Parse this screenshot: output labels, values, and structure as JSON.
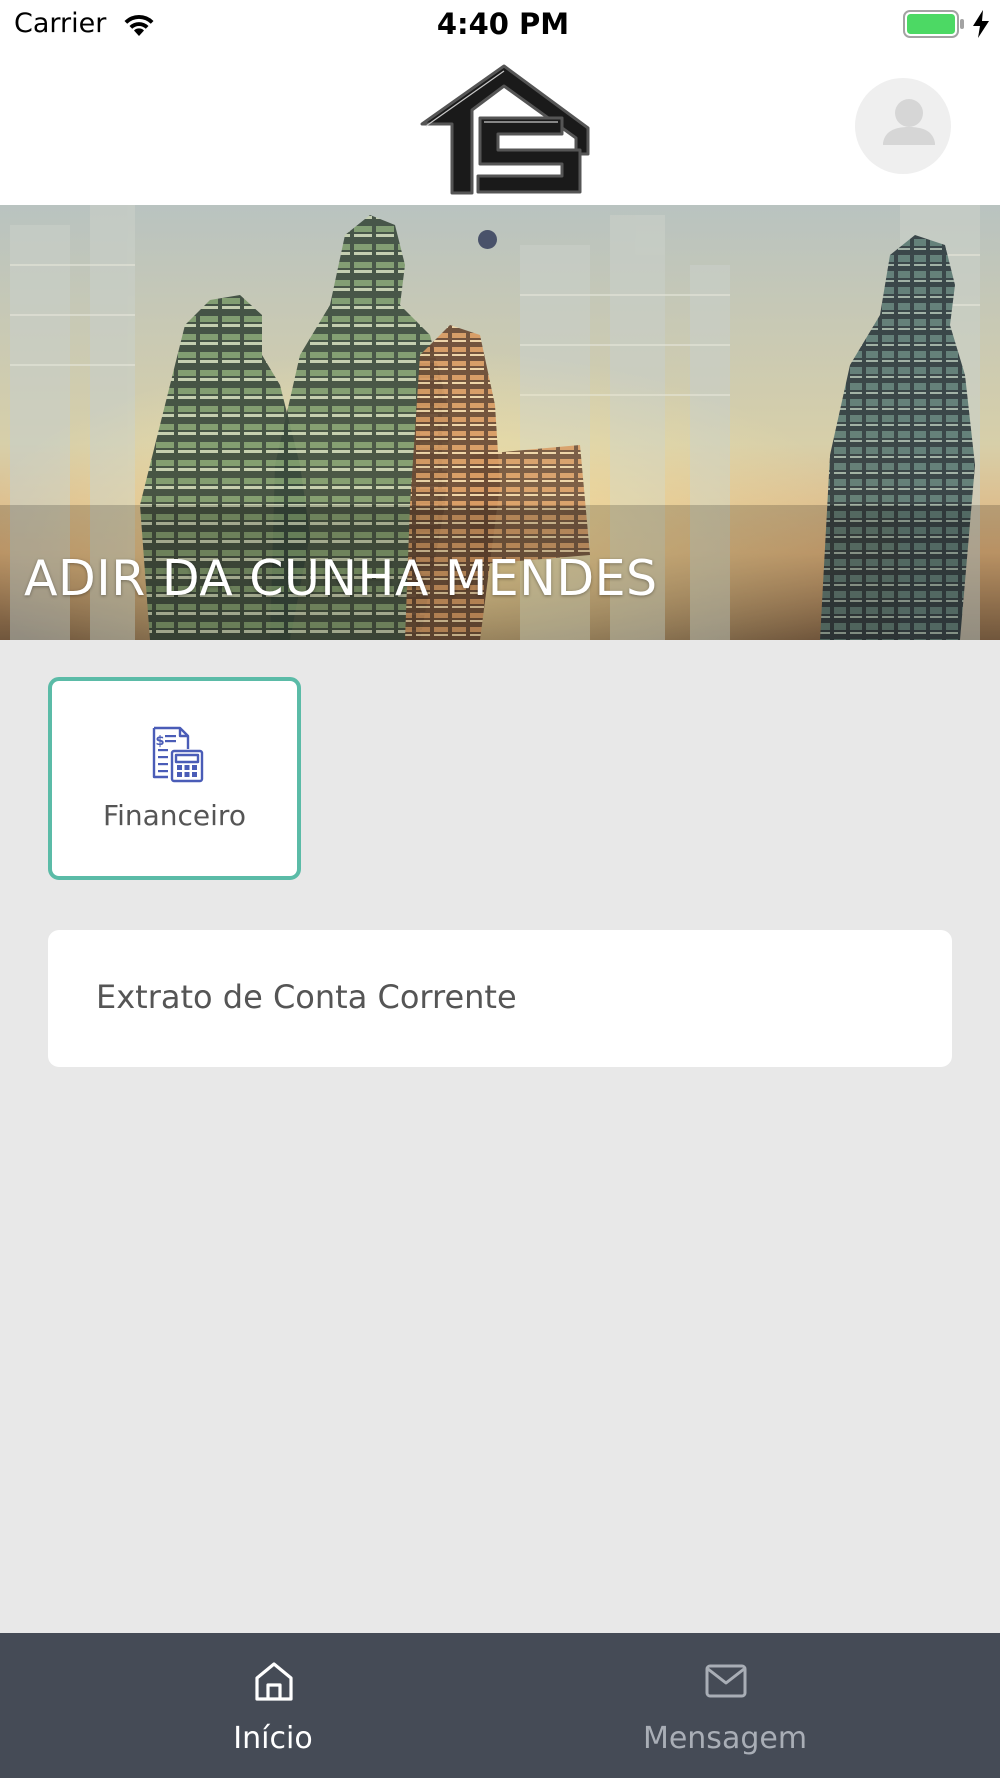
{
  "status_bar": {
    "carrier": "Carrier",
    "time": "4:40 PM",
    "wifi_icon": "wifi-icon",
    "battery_icon": "battery-charging-icon"
  },
  "header": {
    "logo": "TLS",
    "avatar_icon": "user-avatar-icon"
  },
  "banner": {
    "user_name": "ADIR DA CUNHA MENDES",
    "carousel_pages": 1,
    "carousel_active": 1
  },
  "modules": [
    {
      "label": "Financeiro",
      "icon": "financial-calculator-icon"
    }
  ],
  "list": [
    {
      "label": "Extrato de Conta Corrente"
    }
  ],
  "tabs": [
    {
      "label": "Início",
      "icon": "home-icon",
      "active": true
    },
    {
      "label": "Mensagem",
      "icon": "mail-icon",
      "active": false
    }
  ],
  "colors": {
    "accent": "#5bbba7",
    "tab_bar": "#454b56",
    "background": "#e8e8e8",
    "icon_blue": "#4a5cb7"
  }
}
